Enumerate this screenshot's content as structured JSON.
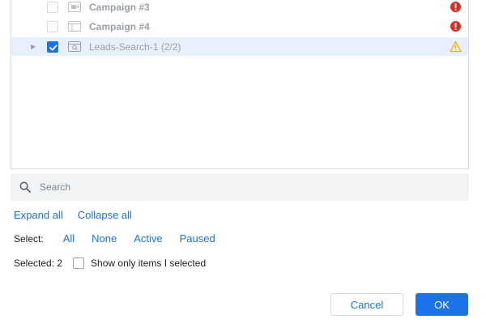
{
  "tree": {
    "rows": [
      {
        "label": "Campaign #3",
        "icon": "video-campaign-icon",
        "status": "error-icon",
        "checked": false
      },
      {
        "label": "Campaign #4",
        "icon": "display-campaign-icon",
        "status": "error-icon",
        "checked": false
      },
      {
        "label": "Leads-Search-1 (2/2)",
        "icon": "search-campaign-icon",
        "status": "warning-icon",
        "checked": true,
        "expandable": true
      }
    ]
  },
  "search": {
    "placeholder": "Search",
    "value": ""
  },
  "links": {
    "expand_all": "Expand all",
    "collapse_all": "Collapse all"
  },
  "select": {
    "label": "Select:",
    "options": [
      "All",
      "None",
      "Active",
      "Paused"
    ]
  },
  "selected": {
    "count_text": "Selected: 2",
    "show_only_label": "Show only items I selected"
  },
  "buttons": {
    "cancel": "Cancel",
    "ok": "OK"
  },
  "colors": {
    "accent": "#1a73e8",
    "error": "#d93025",
    "warning": "#f9ab00",
    "row_selected_bg": "#e8f0fe"
  }
}
